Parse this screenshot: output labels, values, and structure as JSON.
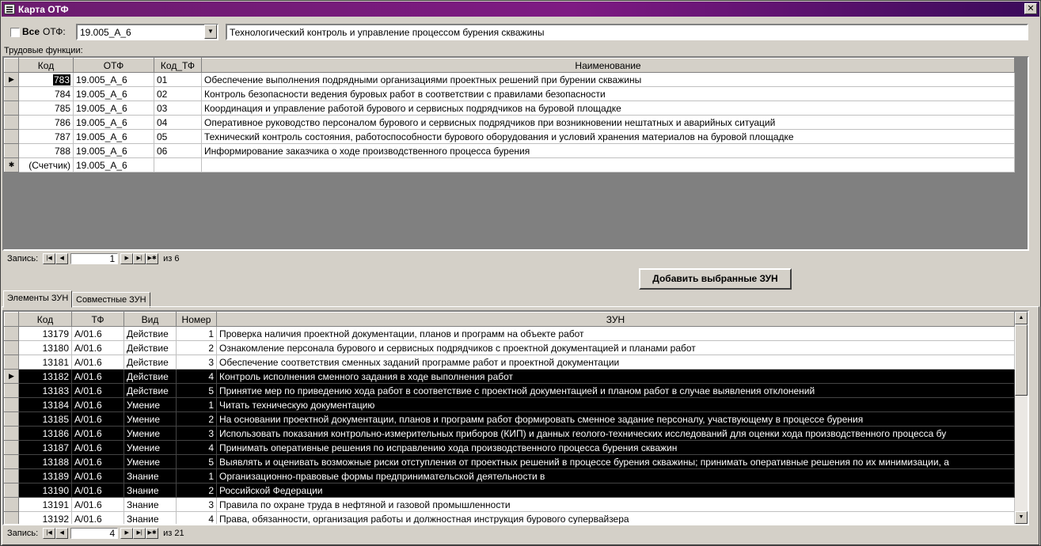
{
  "window": {
    "title": "Карта ОТФ",
    "close": "✕"
  },
  "filter": {
    "all_label": "Все",
    "otf_label": "ОТФ:",
    "otf_value": "19.005_А_6",
    "otf_name": "Технологический контроль и управление процессом бурения скважины"
  },
  "tf_section_label": "Трудовые функции:",
  "tf_grid": {
    "headers": [
      "Код",
      "ОТФ",
      "Код_ТФ",
      "Наименование"
    ],
    "rows": [
      [
        "783",
        "19.005_А_6",
        "01",
        "Обеспечение выполнения подрядными организациями проектных решений при бурении скважины"
      ],
      [
        "784",
        "19.005_А_6",
        "02",
        "Контроль безопасности ведения буровых работ в соответствии с правилами безопасности"
      ],
      [
        "785",
        "19.005_А_6",
        "03",
        "Координация и управление работой бурового и сервисных подрядчиков на буровой площадке"
      ],
      [
        "786",
        "19.005_А_6",
        "04",
        "Оперативное руководство персоналом бурового и сервисных подрядчиков при возникновении нештатных и аварийных ситуаций"
      ],
      [
        "787",
        "19.005_А_6",
        "05",
        "Технический контроль состояния, работоспособности бурового оборудования и условий хранения материалов на буровой площадке"
      ],
      [
        "788",
        "19.005_А_6",
        "06",
        "Информирование заказчика о ходе производственного процесса бурения"
      ]
    ],
    "new_row": [
      "(Счетчик)",
      "19.005_А_6",
      "",
      ""
    ],
    "new_row_marker": "✱",
    "current_marker": "▶"
  },
  "tf_nav": {
    "label": "Запись:",
    "current": "1",
    "of": "из  6"
  },
  "add_button": "Добавить выбранные ЗУН",
  "tabs": [
    "Элементы ЗУН",
    "Совместные ЗУН"
  ],
  "zun_grid": {
    "headers": [
      "Код",
      "ТФ",
      "Вид",
      "Номер",
      "ЗУН"
    ],
    "rows": [
      [
        "13179",
        "A/01.6",
        "Действие",
        "1",
        "Проверка наличия проектной документации, планов и программ на объекте работ"
      ],
      [
        "13180",
        "A/01.6",
        "Действие",
        "2",
        "Ознакомление персонала бурового и сервисных подрядчиков с проектной документацией и планами работ"
      ],
      [
        "13181",
        "A/01.6",
        "Действие",
        "3",
        "Обеспечение соответствия сменных заданий программе работ и проектной документации"
      ],
      [
        "13182",
        "A/01.6",
        "Действие",
        "4",
        "Контроль исполнения сменного задания в ходе выполнения работ"
      ],
      [
        "13183",
        "A/01.6",
        "Действие",
        "5",
        "Принятие мер по приведению хода работ в соответствие с проектной документацией и планом работ в случае выявления отклонений"
      ],
      [
        "13184",
        "A/01.6",
        "Умение",
        "1",
        "Читать техническую документацию"
      ],
      [
        "13185",
        "A/01.6",
        "Умение",
        "2",
        "На основании проектной документации, планов и программ работ формировать сменное задание персоналу, участвующему в процессе бурения"
      ],
      [
        "13186",
        "A/01.6",
        "Умение",
        "3",
        "Использовать показания контрольно-измерительных приборов (КИП) и данных геолого-технических исследований для оценки хода производственного процесса бу"
      ],
      [
        "13187",
        "A/01.6",
        "Умение",
        "4",
        "Принимать оперативные решения по исправлению хода производственного процесса бурения скважин"
      ],
      [
        "13188",
        "A/01.6",
        "Умение",
        "5",
        "Выявлять и оценивать возможные риски отступления от проектных решений в процессе бурения скважины; принимать оперативные решения по их минимизации, а"
      ],
      [
        "13189",
        "A/01.6",
        "Знание",
        "1",
        "Организационно-правовые формы предпринимательской деятельности в"
      ],
      [
        "13190",
        "A/01.6",
        "Знание",
        "2",
        "Российской Федерации"
      ],
      [
        "13191",
        "A/01.6",
        "Знание",
        "3",
        "Правила по охране труда в нефтяной и газовой промышленности"
      ],
      [
        "13192",
        "A/01.6",
        "Знание",
        "4",
        "Права, обязанности, организация работы и должностная инструкция бурового супервайзера"
      ]
    ],
    "selected_rows": [
      3,
      4,
      5,
      6,
      7,
      8,
      9,
      10,
      11
    ],
    "current_row": 3
  },
  "zun_nav": {
    "label": "Запись:",
    "current": "4",
    "of": "из  21"
  }
}
